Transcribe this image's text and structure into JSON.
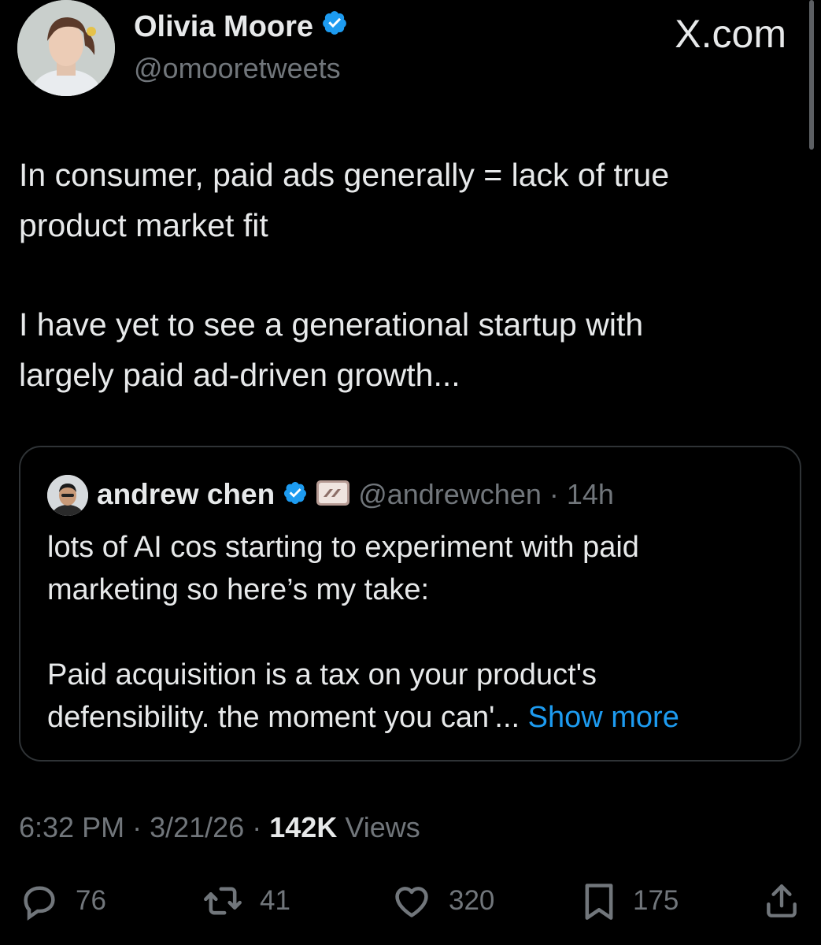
{
  "author": {
    "name": "Olivia Moore",
    "handle": "@omooretweets"
  },
  "brand": "X.com",
  "tweet": {
    "paragraphs": [
      "In consumer, paid ads generally = lack of true\nproduct market fit",
      "I have yet to see a generational startup with\nlargely paid ad-driven growth..."
    ]
  },
  "quote": {
    "name": "andrew chen",
    "handle": "@andrewchen",
    "separator": "·",
    "time": "14h",
    "text1": "lots of AI cos starting to experiment with paid\nmarketing so here’s my take:",
    "text2": "Paid acquisition is a tax on your product's\ndefensibility. the moment you can'...",
    "show_more": "Show more"
  },
  "meta": {
    "time": "6:32 PM",
    "date": "3/21/26",
    "views_count": "142K",
    "views_label": "Views",
    "sep": "·"
  },
  "actions": {
    "replies": "76",
    "reposts": "41",
    "likes": "320",
    "bookmarks": "175"
  },
  "colors": {
    "background": "#000000",
    "text": "#e7e9ea",
    "muted": "#71767b",
    "link": "#1d9bf0",
    "verified": "#1d9bf0",
    "border": "#2f3336"
  },
  "icons": [
    "verified-badge-icon",
    "reply-icon",
    "retweet-icon",
    "like-icon",
    "bookmark-icon",
    "share-icon"
  ]
}
